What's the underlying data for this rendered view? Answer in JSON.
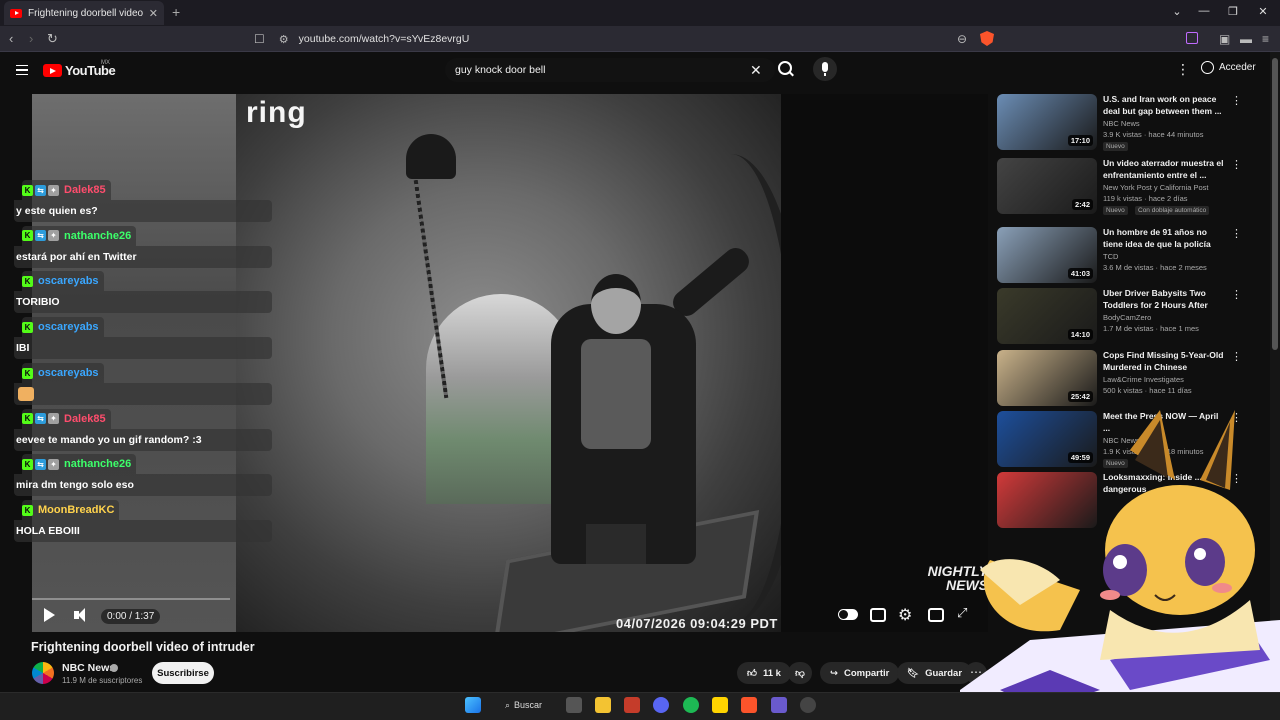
{
  "browser": {
    "tab_title": "Frightening doorbell video of intruder",
    "url": "youtube.com/watch?v=sYvEz8evrgU"
  },
  "youtube": {
    "logo_text": "YouTube",
    "country": "MX",
    "search_value": "guy knock door bell",
    "login_label": "Acceder"
  },
  "video": {
    "cam_brand": "ring",
    "timestamp": "04/07/2026 09:04:29 PDT",
    "watermark": "NIGHTLY NEWS",
    "time": "0:00 / 1:37",
    "progress": 0,
    "title": "Frightening doorbell video of intruder",
    "channel": "NBC News",
    "subscribers": "11.9 M de suscriptores",
    "subscribe_label": "Suscribirse",
    "likes": "11 k",
    "share_label": "Compartir",
    "save_label": "Guardar"
  },
  "chat": [
    {
      "user": "Dalek85",
      "color": "#ff4d6d",
      "badges": [
        "k",
        "t",
        "s"
      ],
      "text": "y este quien es?"
    },
    {
      "user": "nathanche26",
      "color": "#3cff6a",
      "badges": [
        "k",
        "t",
        "s"
      ],
      "text": "estará por ahí en Twitter"
    },
    {
      "user": "oscareyabs",
      "color": "#3aa7ff",
      "badges": [
        "k"
      ],
      "text": "TORIBIO"
    },
    {
      "user": "oscareyabs",
      "color": "#3aa7ff",
      "badges": [
        "k"
      ],
      "text": "IBI"
    },
    {
      "user": "oscareyabs",
      "color": "#3aa7ff",
      "badges": [
        "k"
      ],
      "text": ""
    },
    {
      "user": "Dalek85",
      "color": "#ff4d6d",
      "badges": [
        "k",
        "t",
        "s"
      ],
      "text": "eevee te mando yo un gif random? :3"
    },
    {
      "user": "nathanche26",
      "color": "#3cff6a",
      "badges": [
        "k",
        "t",
        "s"
      ],
      "text": "mira dm tengo solo eso"
    },
    {
      "user": "MoonBreadKC",
      "color": "#ffd34d",
      "badges": [
        "k"
      ],
      "text": "HOLA EBOIII"
    }
  ],
  "recommendations": [
    {
      "title": "U.S. and Iran work on peace deal but gap between them ...",
      "channel": "NBC News",
      "meta": "3.9 K vistas · hace 44 minutos",
      "duration": "17:10",
      "badge": "Nuevo",
      "badge2": "",
      "thumb": "#6b8db5"
    },
    {
      "title": "Un video aterrador muestra el enfrentamiento entre el ...",
      "channel": "New York Post  y California Post",
      "meta": "119 k vistas · hace 2 días",
      "duration": "2:42",
      "badge": "Nuevo",
      "badge2": "Con doblaje automático",
      "thumb": "#444"
    },
    {
      "title": "Un hombre de 91 años no tiene idea de que la policía está a ...",
      "channel": "TCD",
      "meta": "3.6 M de vistas · hace 2 meses",
      "duration": "41:03",
      "badge": "",
      "badge2": "",
      "thumb": "#8aa0b8"
    },
    {
      "title": "Uber Driver Babysits Two Toddlers for 2 Hours After Mo...",
      "channel": "BodyCamZero",
      "meta": "1.7 M de vistas · hace 1 mes",
      "duration": "14:10",
      "badge": "",
      "badge2": "",
      "thumb": "#3a3a2a"
    },
    {
      "title": "Cops Find Missing 5-Year-Old Murdered in Chinese Restaura...",
      "channel": "Law&Crime Investigates",
      "meta": "500 k vistas · hace 11 días",
      "duration": "25:42",
      "badge": "",
      "badge2": "",
      "thumb": "#c9b28a"
    },
    {
      "title": "Meet the Press NOW — April ...",
      "channel": "NBC News",
      "meta": "1.9 K vistas · hace 18 minutos",
      "duration": "49:59",
      "badge": "Nuevo",
      "badge2": "",
      "thumb": "#1d4f9c"
    },
    {
      "title": "Looksmaxxing: Inside ... dangerous ...",
      "channel": "",
      "meta": "",
      "duration": "",
      "badge": "",
      "badge2": "",
      "thumb": "#d23a3a"
    }
  ],
  "taskbar": {
    "search_label": "Buscar"
  },
  "icons": {
    "menu": "hamburger-icon",
    "search": "search-icon",
    "mic": "microphone-icon",
    "like": "thumbs-up-icon",
    "dislike": "thumbs-down-icon",
    "share": "share-icon",
    "save": "bookmark-icon",
    "settings": "gear-icon",
    "fullscreen": "fullscreen-icon"
  }
}
